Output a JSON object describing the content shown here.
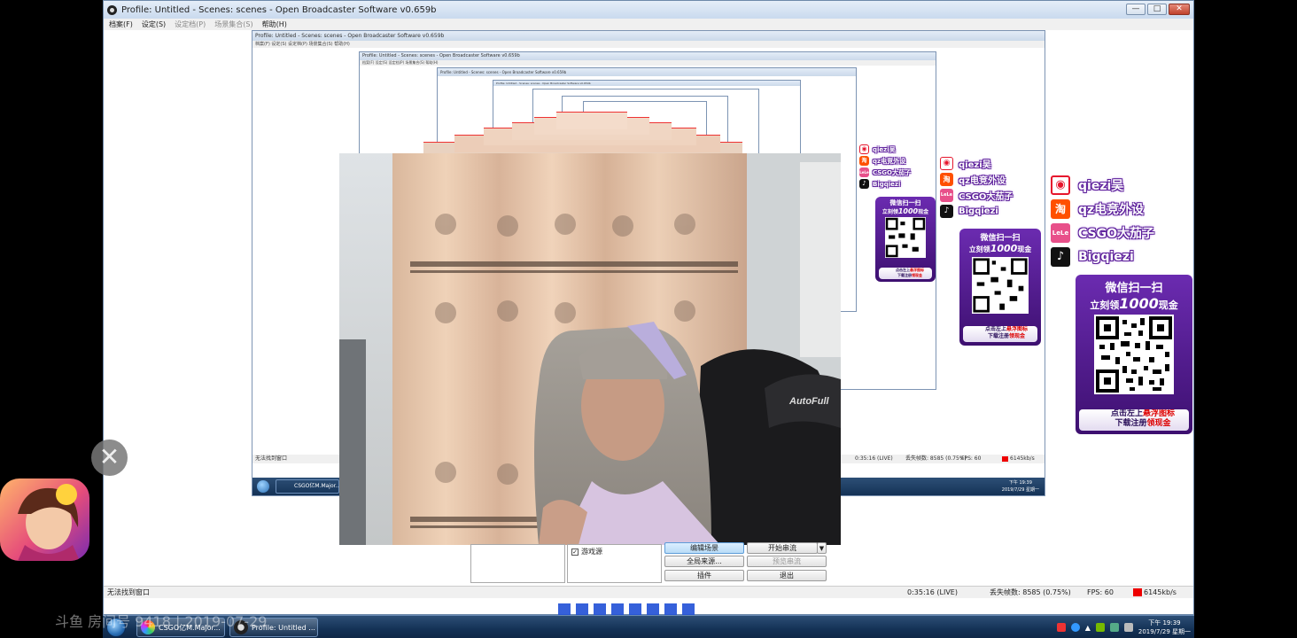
{
  "window": {
    "title": "Profile: Untitled - Scenes: scenes - Open Broadcaster Software v0.659b",
    "controls": {
      "minimize": "—",
      "maximize": "□",
      "close": "✕"
    }
  },
  "menu": [
    "档案(F)",
    "设定(S)",
    "设定档(P)",
    "场景集合(S)",
    "帮助(H)"
  ],
  "nested_title": "Profile: Untitled - Scenes: scenes - Open Broadcaster Software v0.659b",
  "nested_menu": "档案(F)  设定(S)  设定档(P)  场景集合(S)  帮助(H)",
  "nested_status": "无法找到窗口",
  "nested_status_time": "0:35:16 (LIVE)",
  "nested_status_frames": "丢失帧数: 8585 (0.75%)",
  "nested_status_fps": "FPS: 60",
  "nested_status_bitrate": "6145kb/s",
  "status": {
    "left": "无法找到窗口",
    "time": "0:35:16 (LIVE)",
    "dropped": "丢失帧数: 8585 (0.75%)",
    "fps": "FPS: 60",
    "bitrate": "6145kb/s"
  },
  "sources": {
    "item": "游戏源"
  },
  "buttons": {
    "edit_scene": "编辑场景",
    "start_stream": "开始串流",
    "global_sources": "全局来源...",
    "preview": "预览串流",
    "plugins": "插件",
    "exit": "退出"
  },
  "taskbar": {
    "tasks": [
      "CSGO亿M.Major...",
      "Profile: Untitled ..."
    ],
    "nested_task": "CSGO亿M.Major...",
    "clock_time": "下午 19:39",
    "clock_date": "2019/7/29 星期一",
    "nested_clock_time": "下午 19:39",
    "nested_clock_date": "2019/7/29 星期一"
  },
  "sponsors": [
    {
      "icon": "weibo-icon",
      "label": "qiezi吴",
      "color": "#e6162d"
    },
    {
      "icon": "taobao-icon",
      "label": "qz电竞外设",
      "color": "#ff5000"
    },
    {
      "icon": "lele-icon",
      "label": "CSGO大茄子",
      "color": "#e8508a"
    },
    {
      "icon": "douyin-icon",
      "label": "Bigqiezi",
      "color": "#111111"
    }
  ],
  "promo": {
    "line1": "微信扫一扫",
    "line2_pre": "立刻领",
    "line2_num": "1000",
    "line2_post": "现金",
    "foot1_pre": "点击左上",
    "foot1_hl": "悬浮图标",
    "foot2_pre": "下载注册",
    "foot2_hl": "领现金"
  },
  "chair_brand": "AutoFull",
  "overlay": {
    "close_icon": "✕",
    "watermark": "斗鱼 房间号 9418 | 2019-07-29"
  },
  "colors": {
    "accent": "#6b2bb0",
    "status_red": "#e00000",
    "taskbar": "#143256"
  }
}
